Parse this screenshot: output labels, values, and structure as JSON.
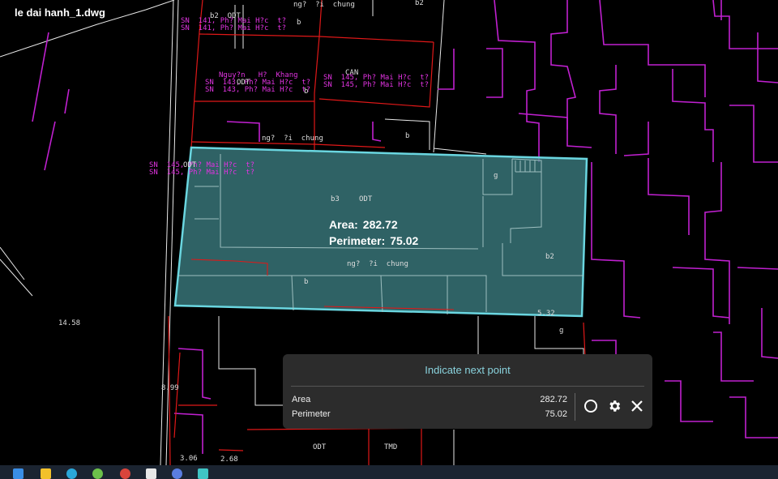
{
  "window": {
    "title": "le dai hanh_1.dwg"
  },
  "measure_overlay": {
    "area_label": "Area:",
    "area_value": "282.72",
    "perimeter_label": "Perimeter:",
    "perimeter_value": "75.02"
  },
  "measure_panel": {
    "prompt": "Indicate next point",
    "rows": [
      {
        "name": "Area",
        "value": "282.72"
      },
      {
        "name": "Perimeter",
        "value": "75.02"
      }
    ],
    "icons": [
      "circle-icon",
      "gear-icon",
      "close-icon"
    ]
  },
  "drawing_labels": {
    "l1": "b2  ODT",
    "l2": "ng?  ?i  chung",
    "l3": "SN  141, Ph? Mai H?c  t?",
    "l4": "SN  141, Ph? Mai H?c  t?",
    "l5": "b",
    "l6": "Nguy?n   H?  Khang",
    "l7": "SN  143, Ph? Mai H?c  t?",
    "l8": "SN  143, Ph? Mai H?c  t?",
    "l9": "ODT",
    "l10": "CAN",
    "l11": "SN  145, Ph? Mai H?c  t?",
    "l12": "SN  145, Ph? Mai H?c  t?",
    "l13": "ng?  ?i  chung",
    "l14": "b3",
    "l15": "ODT",
    "l16": "ng?  ?i  chung",
    "l17": "b2",
    "l18": "SN  145, Ph? Mai H?c  t?",
    "l19": "SN  145, Ph? Mai H?c  t?",
    "l20": "ODT",
    "l21": "14.58",
    "l22": "b",
    "l23": "g",
    "l24": "g",
    "l25": "8.99",
    "l26": "3.06",
    "l27": "2.68",
    "l28": "ODT",
    "l29": "TMD",
    "l30": "b2",
    "l31": "b",
    "l32": "b",
    "l33": "5.32"
  },
  "taskbar": {
    "icons": [
      "file-explorer-icon",
      "edge-icon",
      "chrome-icon",
      "app-icon-1",
      "app-icon-2",
      "app-icon-3",
      "app-icon-4",
      "app-icon-5"
    ]
  }
}
